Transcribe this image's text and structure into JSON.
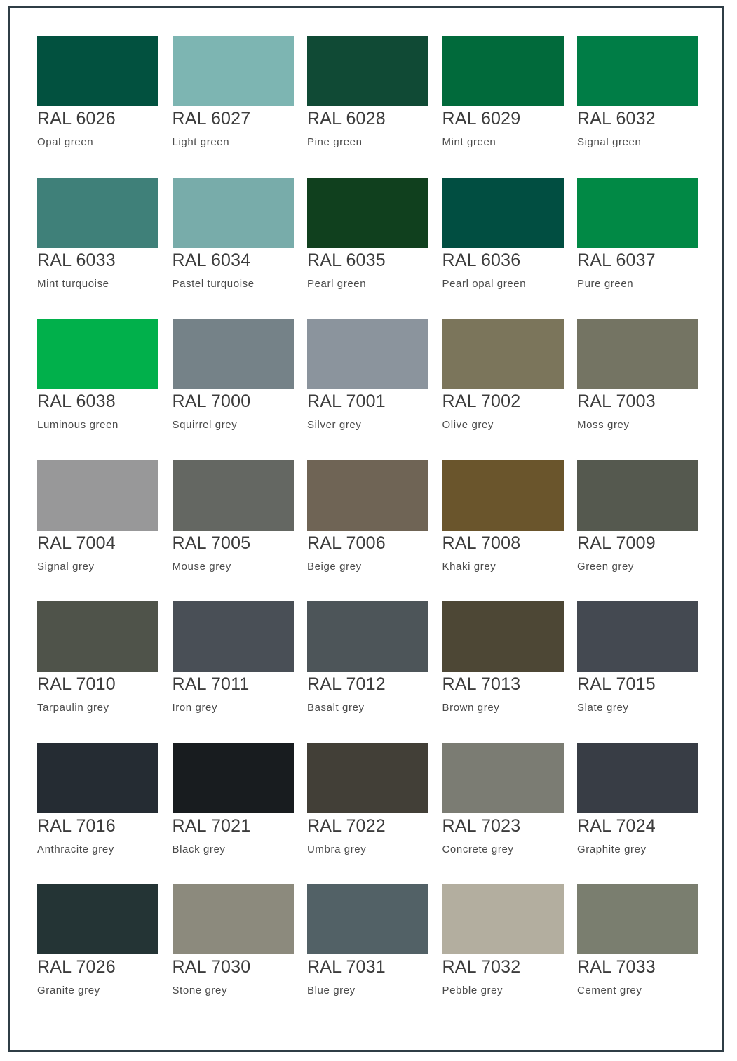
{
  "colors": [
    {
      "code": "RAL 6026",
      "name": "Opal green",
      "hex": "#02513f"
    },
    {
      "code": "RAL 6027",
      "name": "Light green",
      "hex": "#7db5b2"
    },
    {
      "code": "RAL 6028",
      "name": "Pine green",
      "hex": "#104a35"
    },
    {
      "code": "RAL 6029",
      "name": "Mint green",
      "hex": "#016a3b"
    },
    {
      "code": "RAL 6032",
      "name": "Signal green",
      "hex": "#007d46"
    },
    {
      "code": "RAL 6033",
      "name": "Mint turquoise",
      "hex": "#3f8079"
    },
    {
      "code": "RAL 6034",
      "name": "Pastel turquoise",
      "hex": "#78acaa"
    },
    {
      "code": "RAL 6035",
      "name": "Pearl green",
      "hex": "#10401e"
    },
    {
      "code": "RAL 6036",
      "name": "Pearl opal green",
      "hex": "#014e41"
    },
    {
      "code": "RAL 6037",
      "name": "Pure green",
      "hex": "#018945"
    },
    {
      "code": "RAL 6038",
      "name": "Luminous green",
      "hex": "#01b04b"
    },
    {
      "code": "RAL 7000",
      "name": "Squirrel grey",
      "hex": "#758288"
    },
    {
      "code": "RAL 7001",
      "name": "Silver grey",
      "hex": "#8b949d"
    },
    {
      "code": "RAL 7002",
      "name": "Olive grey",
      "hex": "#7b755b"
    },
    {
      "code": "RAL 7003",
      "name": "Moss grey",
      "hex": "#747463"
    },
    {
      "code": "RAL 7004",
      "name": "Signal grey",
      "hex": "#989899"
    },
    {
      "code": "RAL 7005",
      "name": "Mouse grey",
      "hex": "#646762"
    },
    {
      "code": "RAL 7006",
      "name": "Beige grey",
      "hex": "#6f6455"
    },
    {
      "code": "RAL 7008",
      "name": "Khaki grey",
      "hex": "#6a552c"
    },
    {
      "code": "RAL 7009",
      "name": "Green grey",
      "hex": "#55594f"
    },
    {
      "code": "RAL 7010",
      "name": "Tarpaulin grey",
      "hex": "#4f534a"
    },
    {
      "code": "RAL 7011",
      "name": "Iron grey",
      "hex": "#494f56"
    },
    {
      "code": "RAL 7012",
      "name": "Basalt grey",
      "hex": "#4d5559"
    },
    {
      "code": "RAL 7013",
      "name": "Brown grey",
      "hex": "#4d4735"
    },
    {
      "code": "RAL 7015",
      "name": "Slate grey",
      "hex": "#444951"
    },
    {
      "code": "RAL 7016",
      "name": "Anthracite grey",
      "hex": "#252c33"
    },
    {
      "code": "RAL 7021",
      "name": "Black grey",
      "hex": "#181c1f"
    },
    {
      "code": "RAL 7022",
      "name": "Umbra grey",
      "hex": "#423f37"
    },
    {
      "code": "RAL 7023",
      "name": "Concrete grey",
      "hex": "#7b7c73"
    },
    {
      "code": "RAL 7024",
      "name": "Graphite grey",
      "hex": "#383d45"
    },
    {
      "code": "RAL 7026",
      "name": "Granite grey",
      "hex": "#243435"
    },
    {
      "code": "RAL 7030",
      "name": "Stone grey",
      "hex": "#8c8a7d"
    },
    {
      "code": "RAL 7031",
      "name": "Blue grey",
      "hex": "#526166"
    },
    {
      "code": "RAL 7032",
      "name": "Pebble grey",
      "hex": "#b3ae9f"
    },
    {
      "code": "RAL 7033",
      "name": "Cement grey",
      "hex": "#7a7e6f"
    }
  ]
}
